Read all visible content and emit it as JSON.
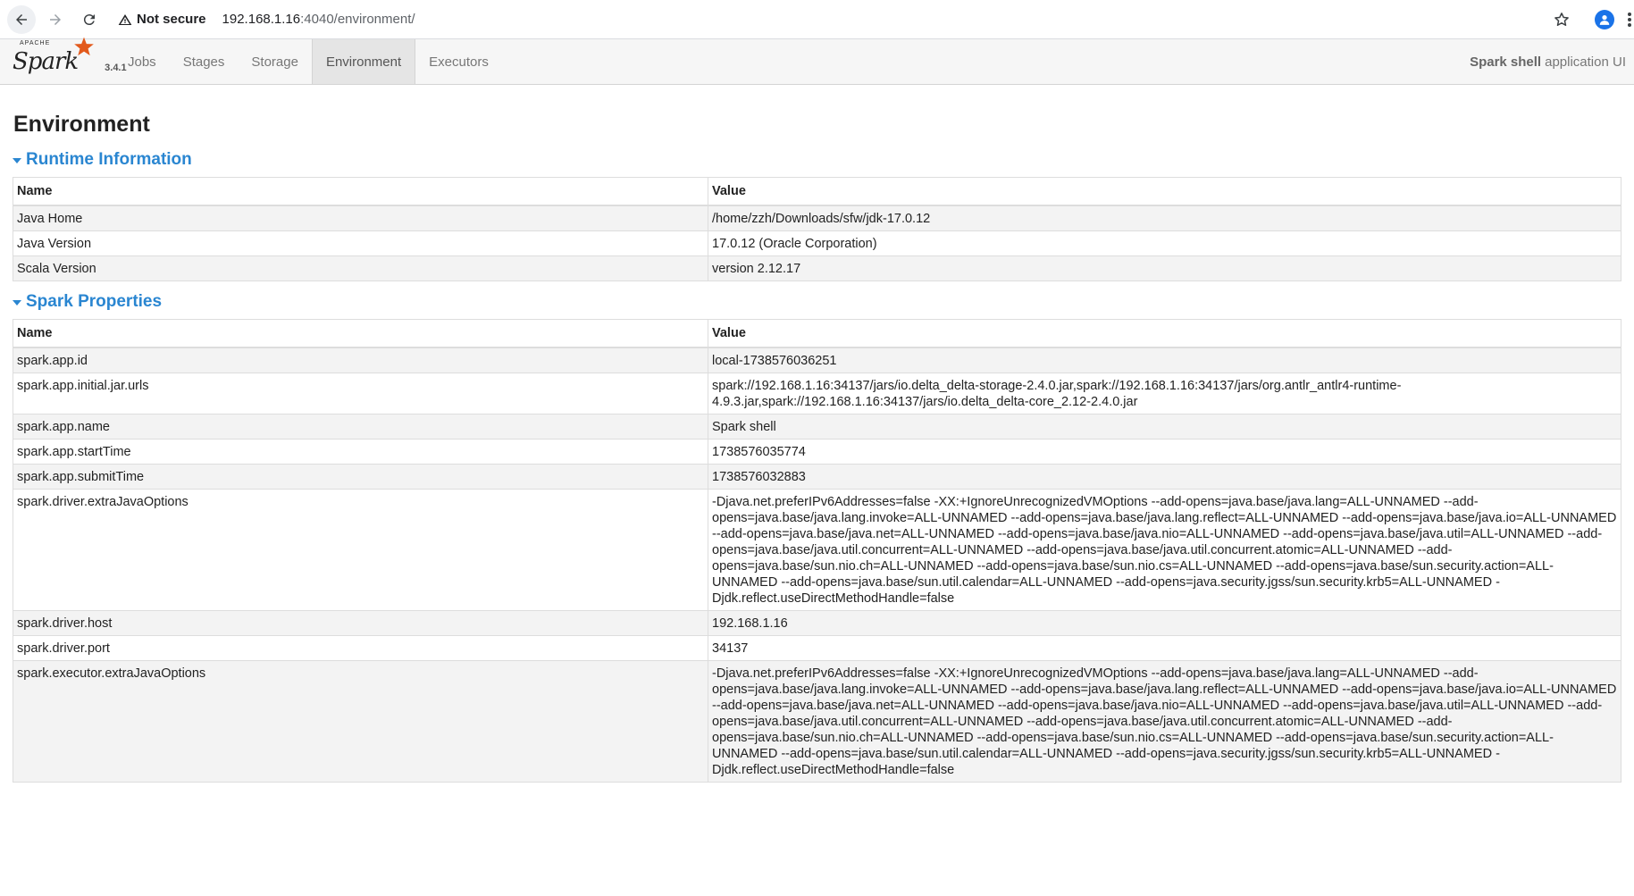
{
  "browser": {
    "security_label": "Not secure",
    "url_host": "192.168.1.16",
    "url_rest": ":4040/environment/"
  },
  "spark": {
    "brand": "Spark",
    "apache": "APACHE",
    "version": "3.4.1",
    "tabs": [
      {
        "label": "Jobs"
      },
      {
        "label": "Stages"
      },
      {
        "label": "Storage"
      },
      {
        "label": "Environment"
      },
      {
        "label": "Executors"
      }
    ],
    "app_name": "Spark shell",
    "app_suffix": "application UI"
  },
  "page": {
    "title": "Environment"
  },
  "runtime": {
    "heading": "Runtime Information",
    "col_name": "Name",
    "col_value": "Value",
    "rows": [
      {
        "name": "Java Home",
        "value": "/home/zzh/Downloads/sfw/jdk-17.0.12"
      },
      {
        "name": "Java Version",
        "value": "17.0.12 (Oracle Corporation)"
      },
      {
        "name": "Scala Version",
        "value": "version 2.12.17"
      }
    ]
  },
  "properties": {
    "heading": "Spark Properties",
    "col_name": "Name",
    "col_value": "Value",
    "rows": [
      {
        "name": "spark.app.id",
        "value": "local-1738576036251"
      },
      {
        "name": "spark.app.initial.jar.urls",
        "value": "spark://192.168.1.16:34137/jars/io.delta_delta-storage-2.4.0.jar,spark://192.168.1.16:34137/jars/org.antlr_antlr4-runtime-4.9.3.jar,spark://192.168.1.16:34137/jars/io.delta_delta-core_2.12-2.4.0.jar"
      },
      {
        "name": "spark.app.name",
        "value": "Spark shell"
      },
      {
        "name": "spark.app.startTime",
        "value": "1738576035774"
      },
      {
        "name": "spark.app.submitTime",
        "value": "1738576032883"
      },
      {
        "name": "spark.driver.extraJavaOptions",
        "value": "-Djava.net.preferIPv6Addresses=false -XX:+IgnoreUnrecognizedVMOptions --add-opens=java.base/java.lang=ALL-UNNAMED --add-opens=java.base/java.lang.invoke=ALL-UNNAMED --add-opens=java.base/java.lang.reflect=ALL-UNNAMED --add-opens=java.base/java.io=ALL-UNNAMED --add-opens=java.base/java.net=ALL-UNNAMED --add-opens=java.base/java.nio=ALL-UNNAMED --add-opens=java.base/java.util=ALL-UNNAMED --add-opens=java.base/java.util.concurrent=ALL-UNNAMED --add-opens=java.base/java.util.concurrent.atomic=ALL-UNNAMED --add-opens=java.base/sun.nio.ch=ALL-UNNAMED --add-opens=java.base/sun.nio.cs=ALL-UNNAMED --add-opens=java.base/sun.security.action=ALL-UNNAMED --add-opens=java.base/sun.util.calendar=ALL-UNNAMED --add-opens=java.security.jgss/sun.security.krb5=ALL-UNNAMED -Djdk.reflect.useDirectMethodHandle=false"
      },
      {
        "name": "spark.driver.host",
        "value": "192.168.1.16"
      },
      {
        "name": "spark.driver.port",
        "value": "34137"
      },
      {
        "name": "spark.executor.extraJavaOptions",
        "value": "-Djava.net.preferIPv6Addresses=false -XX:+IgnoreUnrecognizedVMOptions --add-opens=java.base/java.lang=ALL-UNNAMED --add-opens=java.base/java.lang.invoke=ALL-UNNAMED --add-opens=java.base/java.lang.reflect=ALL-UNNAMED --add-opens=java.base/java.io=ALL-UNNAMED --add-opens=java.base/java.net=ALL-UNNAMED --add-opens=java.base/java.nio=ALL-UNNAMED --add-opens=java.base/java.util=ALL-UNNAMED --add-opens=java.base/java.util.concurrent=ALL-UNNAMED --add-opens=java.base/java.util.concurrent.atomic=ALL-UNNAMED --add-opens=java.base/sun.nio.ch=ALL-UNNAMED --add-opens=java.base/sun.nio.cs=ALL-UNNAMED --add-opens=java.base/sun.security.action=ALL-UNNAMED --add-opens=java.base/sun.util.calendar=ALL-UNNAMED --add-opens=java.security.jgss/sun.security.krb5=ALL-UNNAMED -Djdk.reflect.useDirectMethodHandle=false"
      }
    ]
  },
  "colors": {
    "link": "#2a86d1",
    "star": "#e25a1c",
    "stripe": "#f3f3f3"
  }
}
